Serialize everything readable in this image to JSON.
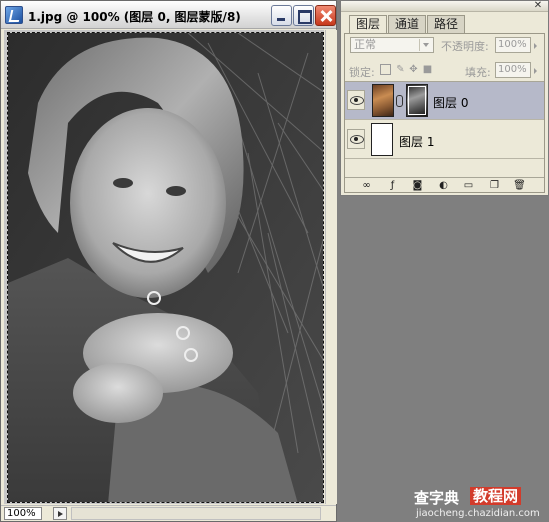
{
  "document_window": {
    "title": "1.jpg @ 100% (图层 0, 图层蒙版/8)",
    "zoom": "100%"
  },
  "layers_panel": {
    "tabs": [
      "图层",
      "通道",
      "路径"
    ],
    "active_tab": "图层",
    "blend_mode": "正常",
    "opacity_label": "不透明度:",
    "opacity_value": "100%",
    "lock_label": "锁定:",
    "fill_label": "填充:",
    "fill_value": "100%",
    "layers": [
      {
        "name": "图层 0",
        "visible": true,
        "selected": true,
        "has_mask": true
      },
      {
        "name": "图层 1",
        "visible": true,
        "selected": false,
        "has_mask": false
      }
    ],
    "footer_icons": [
      "link-icon",
      "layer-style-icon",
      "add-mask-icon",
      "adjustment-layer-icon",
      "new-group-icon",
      "new-layer-icon",
      "delete-layer-icon"
    ]
  },
  "watermark": {
    "line1_a": "查字典",
    "line1_b": "教程网",
    "line2": "jiaocheng.chazidian.com"
  }
}
